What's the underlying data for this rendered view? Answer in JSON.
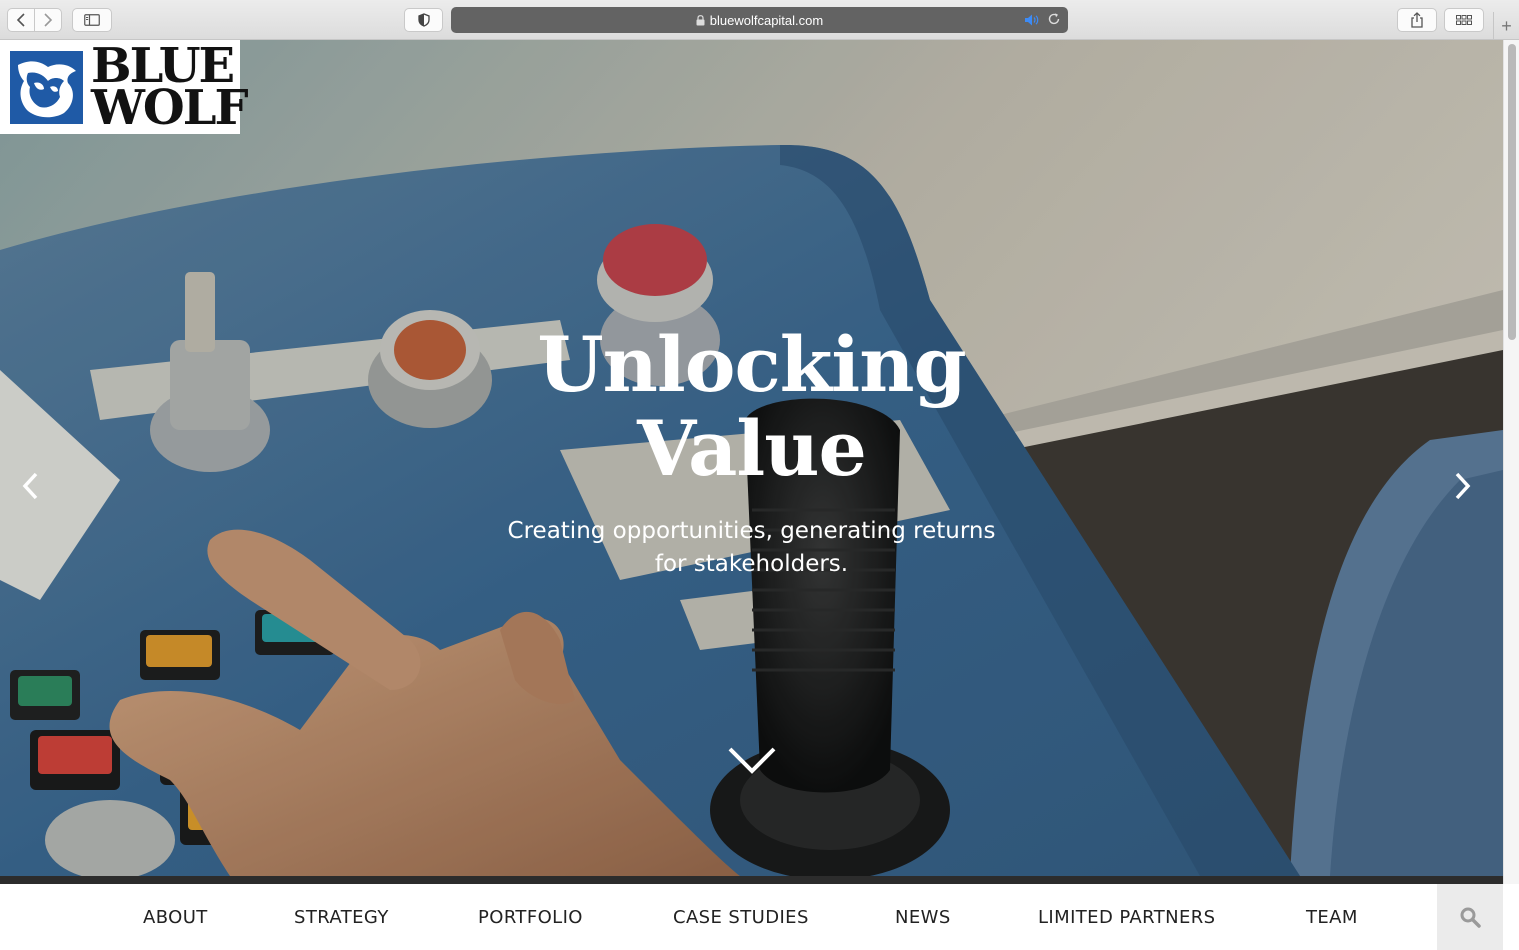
{
  "browser": {
    "url": "bluewolfcapital.com",
    "icons": {
      "back": "chevron-left-icon",
      "forward": "chevron-right-icon",
      "sidebar": "sidebar-icon",
      "privacy": "shield-icon",
      "lock": "lock-icon",
      "audio": "speaker-icon",
      "reload": "reload-icon",
      "share": "share-icon",
      "tabs": "tab-overview-icon",
      "new_tab": "plus-icon"
    },
    "new_tab_glyph": "+"
  },
  "logo": {
    "line1": "BLUE",
    "line2": "WOLF",
    "brand_color": "#1f5aa6"
  },
  "hero": {
    "title_line1": "Unlocking",
    "title_line2": "Value",
    "subtitle": "Creating opportunities, generating returns for stakeholders.",
    "prev_icon": "chevron-left-icon",
    "next_icon": "chevron-right-icon",
    "scroll_icon": "chevron-down-icon"
  },
  "nav": {
    "items": [
      {
        "label": "ABOUT"
      },
      {
        "label": "STRATEGY"
      },
      {
        "label": "PORTFOLIO"
      },
      {
        "label": "CASE STUDIES"
      },
      {
        "label": "NEWS"
      },
      {
        "label": "LIMITED PARTNERS"
      },
      {
        "label": "TEAM"
      }
    ],
    "search_icon": "search-icon"
  },
  "colors": {
    "nav_text": "#222222",
    "search_bg": "#ebebeb",
    "hero_text": "#ffffff"
  }
}
